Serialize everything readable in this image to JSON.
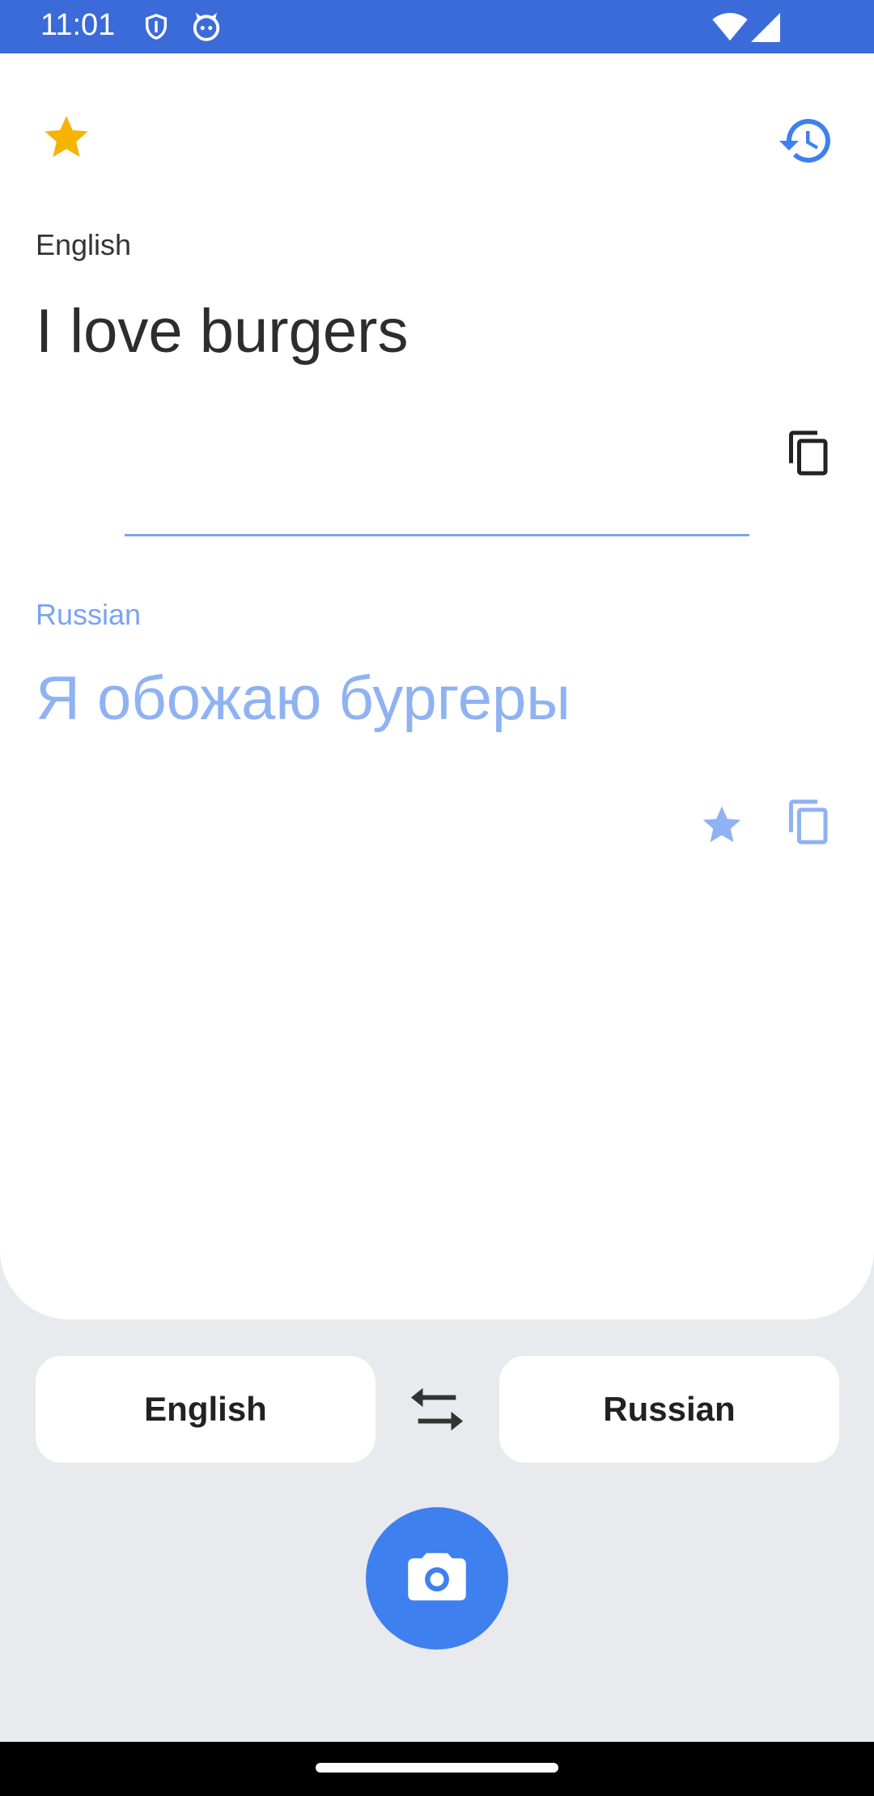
{
  "status_bar": {
    "time": "11:01",
    "icons": [
      "shield-icon",
      "cat-icon",
      "wifi-icon",
      "signal-icon"
    ]
  },
  "toolbar": {
    "favorites_icon": "star-icon",
    "history_icon": "history-icon"
  },
  "source": {
    "language": "English",
    "text": "I love burgers",
    "copy_icon": "copy-icon"
  },
  "target": {
    "language": "Russian",
    "text": "Я обожаю бургеры",
    "favorite_icon": "star-icon",
    "copy_icon": "copy-icon"
  },
  "language_selector": {
    "source": "English",
    "swap_icon": "swap-icon",
    "target": "Russian"
  },
  "camera_button": {
    "icon": "camera-icon"
  },
  "colors": {
    "status_bar": "#3a6bd9",
    "accent": "#3f80ef",
    "star": "#f4b400",
    "target_text": "#8fb2f2",
    "background": "#e9eaee"
  }
}
